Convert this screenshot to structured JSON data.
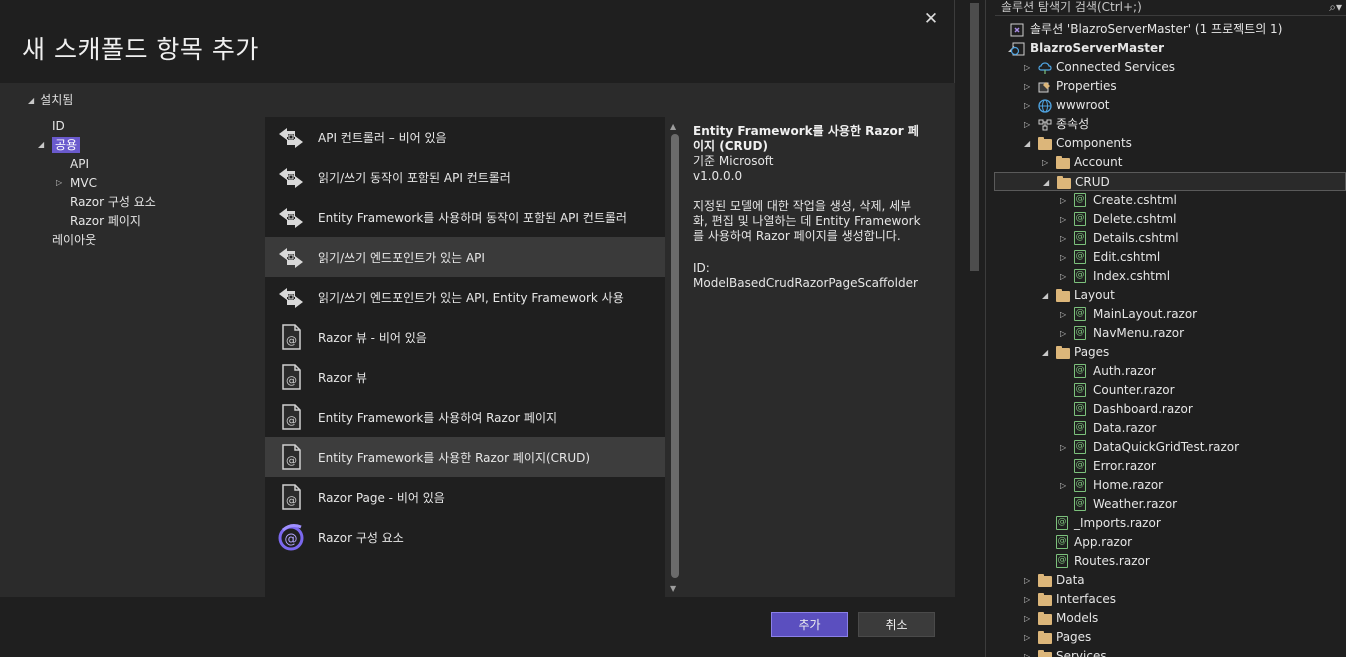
{
  "dialog": {
    "title": "새 스캐폴드 항목 추가",
    "close_label": "✕",
    "installed_label": "설치됨",
    "tree": [
      {
        "label": "ID",
        "indent": 1,
        "expander": ""
      },
      {
        "label": "공용",
        "indent": 1,
        "expander": "open",
        "selected": true
      },
      {
        "label": "API",
        "indent": 2,
        "expander": ""
      },
      {
        "label": "MVC",
        "indent": 2,
        "expander": "closed"
      },
      {
        "label": "Razor 구성 요소",
        "indent": 2,
        "expander": ""
      },
      {
        "label": "Razor 페이지",
        "indent": 2,
        "expander": ""
      },
      {
        "label": "레이아웃",
        "indent": 1,
        "expander": ""
      }
    ],
    "templates": [
      {
        "label": "API 컨트롤러 – 비어 있음",
        "icon": "api-controller-icon"
      },
      {
        "label": "읽기/쓰기 동작이 포함된 API 컨트롤러",
        "icon": "api-controller-icon"
      },
      {
        "label": "Entity Framework를 사용하며 동작이 포함된 API 컨트롤러",
        "icon": "api-controller-icon"
      },
      {
        "label": "읽기/쓰기 엔드포인트가 있는 API",
        "icon": "api-controller-icon",
        "state": "hover"
      },
      {
        "label": "읽기/쓰기 엔드포인트가 있는 API, Entity Framework 사용",
        "icon": "api-controller-icon"
      },
      {
        "label": "Razor 뷰 - 비어 있음",
        "icon": "razor-file-icon"
      },
      {
        "label": "Razor 뷰",
        "icon": "razor-file-icon"
      },
      {
        "label": "Entity Framework를 사용하여 Razor 페이지",
        "icon": "razor-file-icon"
      },
      {
        "label": "Entity Framework를 사용한 Razor 페이지(CRUD)",
        "icon": "razor-file-icon",
        "state": "selected"
      },
      {
        "label": "Razor Page - 비어 있음",
        "icon": "razor-file-icon"
      },
      {
        "label": "Razor 구성 요소",
        "icon": "blazor-icon"
      }
    ],
    "detail": {
      "title": "Entity Framework를 사용한 Razor 페이지 (CRUD)",
      "author": "기준 Microsoft",
      "version": "v1.0.0.0",
      "description": "지정된 모델에 대한 작업을 생성, 삭제, 세부화, 편집 및 나열하는 데 Entity Framework를 사용하여 Razor 페이지를 생성합니다.",
      "id": "ID: ModelBasedCrudRazorPageScaffolder"
    },
    "buttons": {
      "add": "추가",
      "cancel": "취소"
    }
  },
  "solution_explorer": {
    "search_placeholder": "솔루션 탐색기 검색(Ctrl+;)",
    "rows": [
      {
        "label": "솔루션 'BlazroServerMaster' (1 프로젝트의 1)",
        "level": 0,
        "expander": "",
        "icon": "solution-icon"
      },
      {
        "label": "BlazroServerMaster",
        "level": 0,
        "expander": "open",
        "icon": "project-icon",
        "bold": true
      },
      {
        "label": "Connected Services",
        "level": 1,
        "expander": "closed",
        "icon": "connected-services-icon"
      },
      {
        "label": "Properties",
        "level": 1,
        "expander": "closed",
        "icon": "properties-icon"
      },
      {
        "label": "wwwroot",
        "level": 1,
        "expander": "closed",
        "icon": "globe-icon"
      },
      {
        "label": "종속성",
        "level": 1,
        "expander": "closed",
        "icon": "dependencies-icon"
      },
      {
        "label": "Components",
        "level": 1,
        "expander": "open",
        "icon": "folder-icon"
      },
      {
        "label": "Account",
        "level": 2,
        "expander": "closed",
        "icon": "folder-icon"
      },
      {
        "label": "CRUD",
        "level": 2,
        "expander": "open",
        "icon": "folder-icon",
        "selected": true
      },
      {
        "label": "Create.cshtml",
        "level": 3,
        "expander": "closed",
        "icon": "razor-file-icon"
      },
      {
        "label": "Delete.cshtml",
        "level": 3,
        "expander": "closed",
        "icon": "razor-file-icon"
      },
      {
        "label": "Details.cshtml",
        "level": 3,
        "expander": "closed",
        "icon": "razor-file-icon"
      },
      {
        "label": "Edit.cshtml",
        "level": 3,
        "expander": "closed",
        "icon": "razor-file-icon"
      },
      {
        "label": "Index.cshtml",
        "level": 3,
        "expander": "closed",
        "icon": "razor-file-icon"
      },
      {
        "label": "Layout",
        "level": 2,
        "expander": "open",
        "icon": "folder-icon"
      },
      {
        "label": "MainLayout.razor",
        "level": 3,
        "expander": "closed",
        "icon": "razor-file-icon"
      },
      {
        "label": "NavMenu.razor",
        "level": 3,
        "expander": "closed",
        "icon": "razor-file-icon"
      },
      {
        "label": "Pages",
        "level": 2,
        "expander": "open",
        "icon": "folder-icon"
      },
      {
        "label": "Auth.razor",
        "level": 3,
        "expander": "",
        "icon": "razor-file-icon"
      },
      {
        "label": "Counter.razor",
        "level": 3,
        "expander": "",
        "icon": "razor-file-icon"
      },
      {
        "label": "Dashboard.razor",
        "level": 3,
        "expander": "",
        "icon": "razor-file-icon"
      },
      {
        "label": "Data.razor",
        "level": 3,
        "expander": "",
        "icon": "razor-file-icon"
      },
      {
        "label": "DataQuickGridTest.razor",
        "level": 3,
        "expander": "closed",
        "icon": "razor-file-icon"
      },
      {
        "label": "Error.razor",
        "level": 3,
        "expander": "",
        "icon": "razor-file-icon"
      },
      {
        "label": "Home.razor",
        "level": 3,
        "expander": "closed",
        "icon": "razor-file-icon"
      },
      {
        "label": "Weather.razor",
        "level": 3,
        "expander": "",
        "icon": "razor-file-icon"
      },
      {
        "label": "_Imports.razor",
        "level": 2,
        "expander": "",
        "icon": "razor-file-icon"
      },
      {
        "label": "App.razor",
        "level": 2,
        "expander": "",
        "icon": "razor-file-icon"
      },
      {
        "label": "Routes.razor",
        "level": 2,
        "expander": "",
        "icon": "razor-file-icon"
      },
      {
        "label": "Data",
        "level": 1,
        "expander": "closed",
        "icon": "folder-icon"
      },
      {
        "label": "Interfaces",
        "level": 1,
        "expander": "closed",
        "icon": "folder-icon"
      },
      {
        "label": "Models",
        "level": 1,
        "expander": "closed",
        "icon": "folder-icon"
      },
      {
        "label": "Pages",
        "level": 1,
        "expander": "closed",
        "icon": "folder-icon"
      },
      {
        "label": "Services",
        "level": 1,
        "expander": "closed",
        "icon": "folder-icon"
      }
    ]
  }
}
